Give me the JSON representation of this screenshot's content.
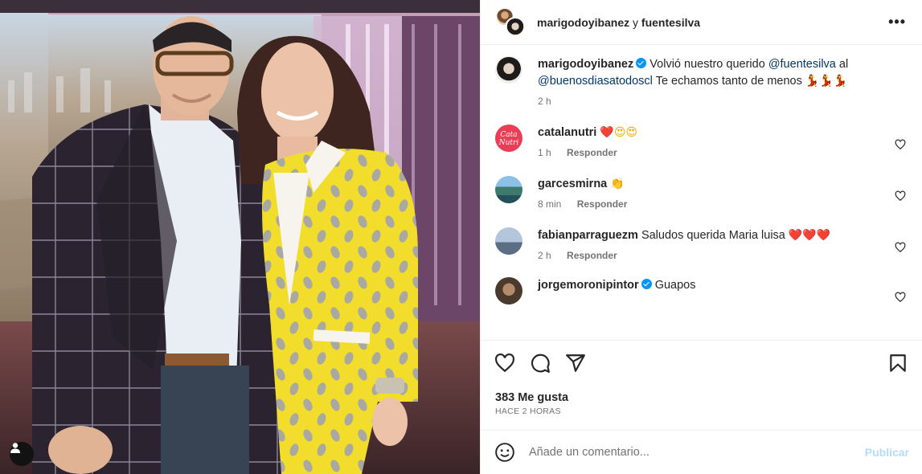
{
  "header": {
    "user1": "marigodoyibanez",
    "connector": "y",
    "user2": "fuentesilva",
    "more_label": "•••"
  },
  "caption": {
    "user": "marigodoyibanez",
    "text_before": "Volvió nuestro querido",
    "mention1": "@fuentesilva",
    "text_mid": "al",
    "mention2": "@buenosdiasatodoscl",
    "text_after": "Te echamos tanto de menos",
    "emojis": "💃💃💃",
    "time": "2 h"
  },
  "comments": [
    {
      "user": "catalanutri",
      "verified": false,
      "text": "",
      "emojis": [
        "❤️",
        "😍",
        "😍"
      ],
      "time": "1 h",
      "reply": "Responder",
      "avatar": "cata-nutri-logo"
    },
    {
      "user": "garcesmirna",
      "verified": false,
      "text": "",
      "emojis": [
        "👏"
      ],
      "time": "8 min",
      "reply": "Responder",
      "avatar": "landscape-photo"
    },
    {
      "user": "fabianparraguezm",
      "verified": false,
      "text": "Saludos querida Maria luisa",
      "emojis": [
        "❤️",
        "❤️",
        "❤️"
      ],
      "time": "2 h",
      "reply": "Responder",
      "avatar": "beach-photo"
    },
    {
      "user": "jorgemoronipintor",
      "verified": true,
      "text": "Guapos",
      "emojis": [],
      "time": "",
      "reply": "",
      "avatar": "man-portrait"
    }
  ],
  "actions": {
    "likes": "383 Me gusta",
    "posted_ago": "HACE 2 HORAS"
  },
  "add_comment": {
    "placeholder": "Añade un comentario...",
    "publish_label": "Publicar"
  },
  "icons": {
    "like": "heart-icon",
    "comment": "comment-icon",
    "share": "send-icon",
    "save": "bookmark-icon",
    "emoji": "smile-icon",
    "tag": "user-tag-icon",
    "verified": "verified-badge-icon"
  },
  "colors": {
    "verified": "#0095f6",
    "link": "#00376b",
    "publish_disabled": "#b3dbff",
    "secondary_text": "#737373"
  }
}
